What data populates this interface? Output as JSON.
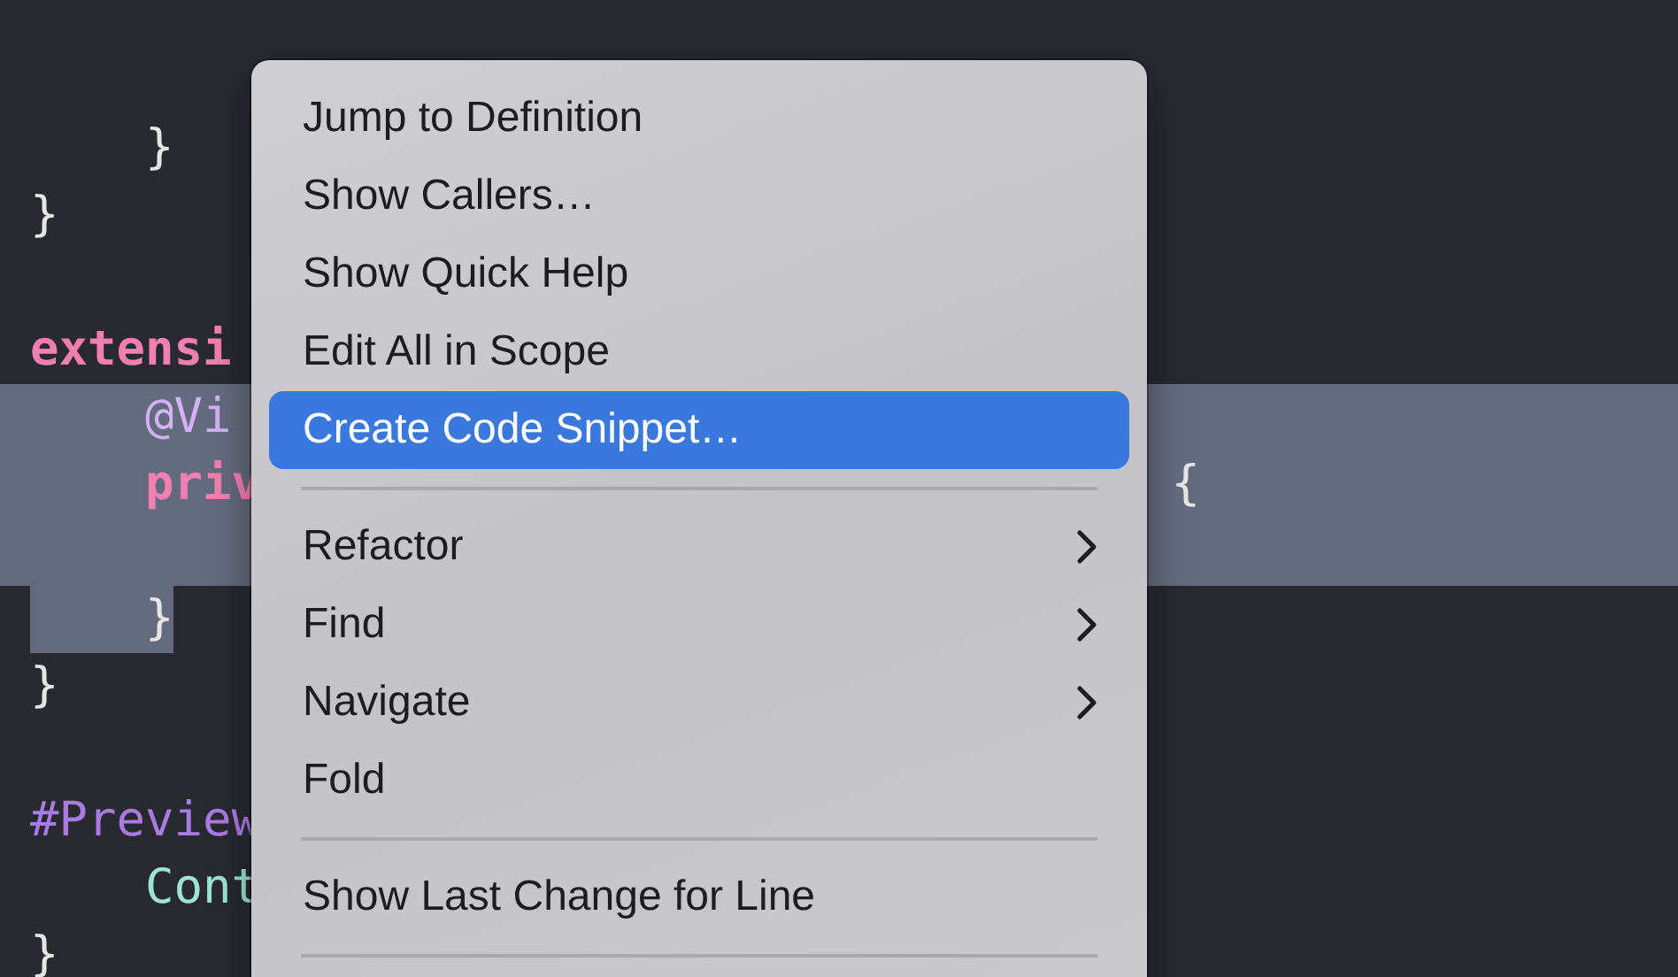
{
  "editor": {
    "lines": [
      {
        "selected": false,
        "segments": [
          {
            "text": "    }",
            "kind": "plain",
            "selected": false
          }
        ]
      },
      {
        "selected": false,
        "segments": [
          {
            "text": "}",
            "kind": "plain",
            "selected": false
          }
        ]
      },
      {
        "selected": false
      },
      {
        "selected": false,
        "segments": [
          {
            "text": "extensi",
            "kind": "keyword",
            "selected": false
          }
        ]
      },
      {
        "selected": true,
        "segments": [
          {
            "text": "    @Vi",
            "kind": "attribute"
          }
        ]
      },
      {
        "selected": true,
        "segments": [
          {
            "text": "    priv",
            "kind": "keyword"
          }
        ],
        "trailing": {
          "text": "{",
          "kind": "plain"
        }
      },
      {
        "selected": true
      },
      {
        "selected": false,
        "segments": [
          {
            "text": "    }",
            "kind": "plain",
            "selected": true
          }
        ]
      },
      {
        "selected": false,
        "segments": [
          {
            "text": "}",
            "kind": "plain",
            "selected": false
          }
        ]
      },
      {
        "selected": false
      },
      {
        "selected": false,
        "segments": [
          {
            "text": "#Preview",
            "kind": "directive",
            "selected": false
          }
        ]
      },
      {
        "selected": false,
        "segments": [
          {
            "text": "    Cont",
            "kind": "type",
            "selected": false
          }
        ]
      },
      {
        "selected": false,
        "segments": [
          {
            "text": "}",
            "kind": "plain",
            "selected": false
          }
        ]
      }
    ]
  },
  "context_menu": {
    "groups": [
      {
        "items": [
          {
            "label": "Jump to Definition",
            "selected": false,
            "submenu": false
          },
          {
            "label": "Show Callers…",
            "selected": false,
            "submenu": false
          },
          {
            "label": "Show Quick Help",
            "selected": false,
            "submenu": false
          },
          {
            "label": "Edit All in Scope",
            "selected": false,
            "submenu": false
          },
          {
            "label": "Create Code Snippet…",
            "selected": true,
            "submenu": false
          }
        ]
      },
      {
        "items": [
          {
            "label": "Refactor",
            "selected": false,
            "submenu": true
          },
          {
            "label": "Find",
            "selected": false,
            "submenu": true
          },
          {
            "label": "Navigate",
            "selected": false,
            "submenu": true
          },
          {
            "label": "Fold",
            "selected": false,
            "submenu": false
          }
        ]
      },
      {
        "items": [
          {
            "label": "Show Last Change for Line",
            "selected": false,
            "submenu": false
          }
        ]
      }
    ]
  }
}
